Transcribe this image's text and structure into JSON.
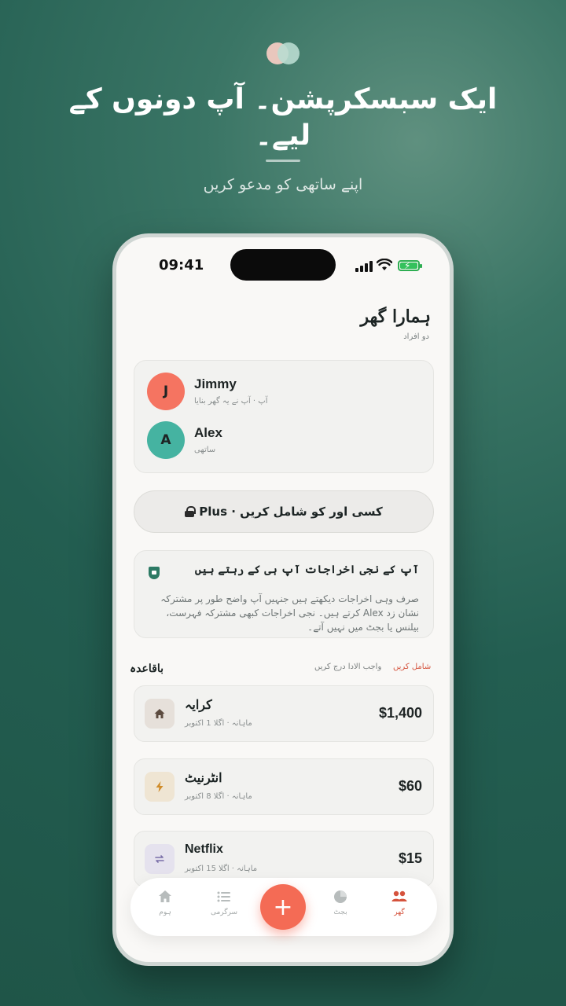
{
  "marketing": {
    "headline": "ایک سبسکرپشن۔ آپ دونوں کے لیے۔",
    "subline": "اپنے ساتھی کو مدعو کریں"
  },
  "status_bar": {
    "time": "09:41"
  },
  "home": {
    "title": "ہمارا گھر",
    "subtitle": "دو افراد"
  },
  "members": [
    {
      "initial": "J",
      "name": "Jimmy",
      "role": "آپ · آپ نے یہ گھر بنایا",
      "color": "#f57461"
    },
    {
      "initial": "A",
      "name": "Alex",
      "role": "ساتھی",
      "color": "#45b3a1"
    }
  ],
  "invite_button": {
    "label": "کسی اور کو شامل کریں · Plus"
  },
  "privacy_card": {
    "title": "آپ کے نجی اخراجات آپ ہی کے رہتے ہیں",
    "body": "صرف وہی اخراجات دیکھتے ہیں جنہیں آپ واضح طور پر مشترکہ نشان زد Alex کرتے ہیں۔ نجی اخراجات کبھی مشترکہ فہرست، بیلنس یا بجٹ میں نہیں آتے۔"
  },
  "recurring": {
    "title": "باقاعدہ",
    "add_link": "شامل کریں",
    "debt_link": "واجب الادا درج کریں"
  },
  "expenses": [
    {
      "name": "کرایہ",
      "meta": "ماہانہ · اگلا 1 اکتوبر",
      "amount": "$1,400",
      "icon": "house-icon",
      "icon_bg": "#e6e0da",
      "icon_color": "#6b5a4d"
    },
    {
      "name": "انٹرنیٹ",
      "meta": "ماہانہ · اگلا 8 اکتوبر",
      "amount": "$60",
      "icon": "lightning-icon",
      "icon_bg": "#efe5d3",
      "icon_color": "#d08c2a"
    },
    {
      "name": "Netflix",
      "meta": "ماہانہ · اگلا 15 اکتوبر",
      "amount": "$15",
      "icon": "repeat-icon",
      "icon_bg": "#e5e2ee",
      "icon_color": "#7a6ea8"
    }
  ],
  "tabbar": {
    "items": [
      {
        "label": "ہوم",
        "icon": "home-icon"
      },
      {
        "label": "سرگرمی",
        "icon": "list-icon"
      },
      {
        "label": "بجٹ",
        "icon": "pie-chart-icon"
      },
      {
        "label": "گھر",
        "icon": "people-icon",
        "active": true
      }
    ],
    "add_label": "+"
  },
  "colors": {
    "accent": "#f46b55",
    "brand_green": "#2c7a64"
  }
}
